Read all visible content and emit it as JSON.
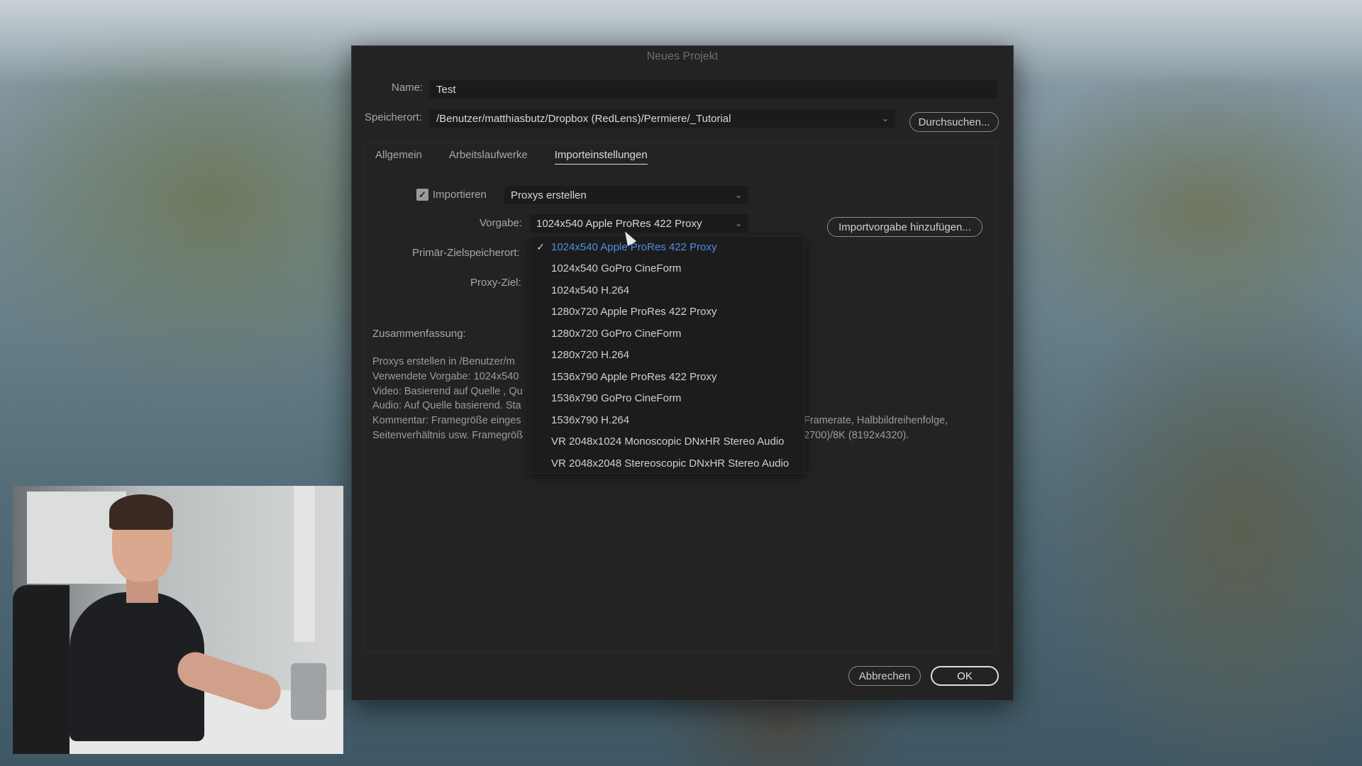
{
  "dialog": {
    "title": "Neues Projekt",
    "name_label": "Name:",
    "name_value": "Test",
    "location_label": "Speicherort:",
    "location_value": "/Benutzer/matthiasbutz/Dropbox (RedLens)/Permiere/_Tutorial",
    "browse_label": "Durchsuchen...",
    "tabs": [
      {
        "label": "Allgemein",
        "active": false
      },
      {
        "label": "Arbeitslaufwerke",
        "active": false
      },
      {
        "label": "Importeinstellungen",
        "active": true
      }
    ],
    "import_checkbox_label": "Importieren",
    "import_checked": true,
    "import_mode": "Proxys erstellen",
    "preset_label": "Vorgabe:",
    "preset_value": "1024x540 Apple ProRes 422 Proxy",
    "add_preset_label": "Importvorgabe hinzufügen...",
    "primary_target_label": "Primär-Zielspeicherort:",
    "proxy_target_label": "Proxy-Ziel:",
    "summary_label": "Zusammenfassung:",
    "summary_left": [
      "Proxys erstellen in /Benutzer/m",
      "Verwendete Vorgabe: 1024x540",
      "Video: Basierend auf Quelle , Qu",
      "Audio: Auf Quelle basierend. Sta",
      "Kommentar: Framegröße einges",
      "Seitenverhältnis usw. Framegröß"
    ],
    "summary_right": [
      "Framerate, Halbbildreihenfolge,",
      "2700)/8K (8192x4320)."
    ],
    "cancel_label": "Abbrechen",
    "ok_label": "OK"
  },
  "dropdown": {
    "options": [
      "1024x540 Apple ProRes 422 Proxy",
      "1024x540 GoPro CineForm",
      "1024x540 H.264",
      "1280x720 Apple ProRes 422 Proxy",
      "1280x720 GoPro CineForm",
      "1280x720 H.264",
      "1536x790 Apple ProRes 422 Proxy",
      "1536x790 GoPro CineForm",
      "1536x790 H.264",
      "VR 2048x1024 Monoscopic DNxHR Stereo Audio",
      "VR 2048x2048 Stereoscopic DNxHR Stereo Audio"
    ],
    "selected_index": 0
  },
  "colors": {
    "dialog_bg": "#232323",
    "selected_option": "#4d8fe4"
  }
}
